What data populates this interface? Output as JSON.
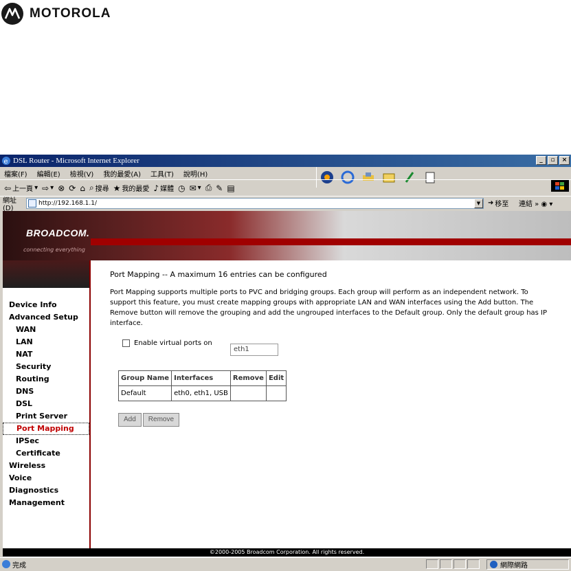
{
  "brand": {
    "name": "MOTOROLA"
  },
  "window": {
    "title": "DSL Router - Microsoft Internet Explorer"
  },
  "menus": [
    "檔案(F)",
    "編輯(E)",
    "檢視(V)",
    "我的最愛(A)",
    "工具(T)",
    "說明(H)"
  ],
  "toolbar": {
    "back": "上一頁",
    "search": "搜尋",
    "favorites": "我的最愛",
    "media": "媒體"
  },
  "address": {
    "label": "網址(D)",
    "url": "http://192.168.1.1/",
    "go": "移至",
    "links": "連結"
  },
  "page": {
    "brand": "BROADCOM.",
    "tagline": "connecting everything",
    "nav": [
      {
        "label": "Device Info",
        "level": 0
      },
      {
        "label": "Advanced Setup",
        "level": 0
      },
      {
        "label": "WAN",
        "level": 1
      },
      {
        "label": "LAN",
        "level": 1
      },
      {
        "label": "NAT",
        "level": 1
      },
      {
        "label": "Security",
        "level": 1
      },
      {
        "label": "Routing",
        "level": 1
      },
      {
        "label": "DNS",
        "level": 1
      },
      {
        "label": "DSL",
        "level": 1
      },
      {
        "label": "Print Server",
        "level": 1
      },
      {
        "label": "Port Mapping",
        "level": 1,
        "active": true
      },
      {
        "label": "IPSec",
        "level": 1
      },
      {
        "label": "Certificate",
        "level": 1
      },
      {
        "label": "Wireless",
        "level": 0
      },
      {
        "label": "Voice",
        "level": 0
      },
      {
        "label": "Diagnostics",
        "level": 0
      },
      {
        "label": "Management",
        "level": 0
      }
    ],
    "heading": "Port Mapping -- A maximum 16 entries can be configured",
    "description": "Port Mapping supports multiple ports to PVC and bridging groups. Each group will perform as an independent network. To support this feature, you must create mapping groups with appropriate LAN and WAN interfaces using the Add button. The Remove button will remove the grouping and add the ungrouped interfaces to the Default group. Only the default group has IP interface.",
    "virtual_ports": {
      "label": "Enable virtual ports on",
      "value": "eth1"
    },
    "table": {
      "headers": [
        "Group Name",
        "Interfaces",
        "Remove",
        "Edit"
      ],
      "rows": [
        {
          "group": "Default",
          "interfaces": "eth0, eth1, USB",
          "remove": "",
          "edit": ""
        }
      ]
    },
    "buttons": {
      "add": "Add",
      "remove": "Remove"
    },
    "footer": "©2000-2005 Broadcom Corporation. All rights reserved."
  },
  "status": {
    "done": "完成",
    "zone": "網際網路"
  }
}
